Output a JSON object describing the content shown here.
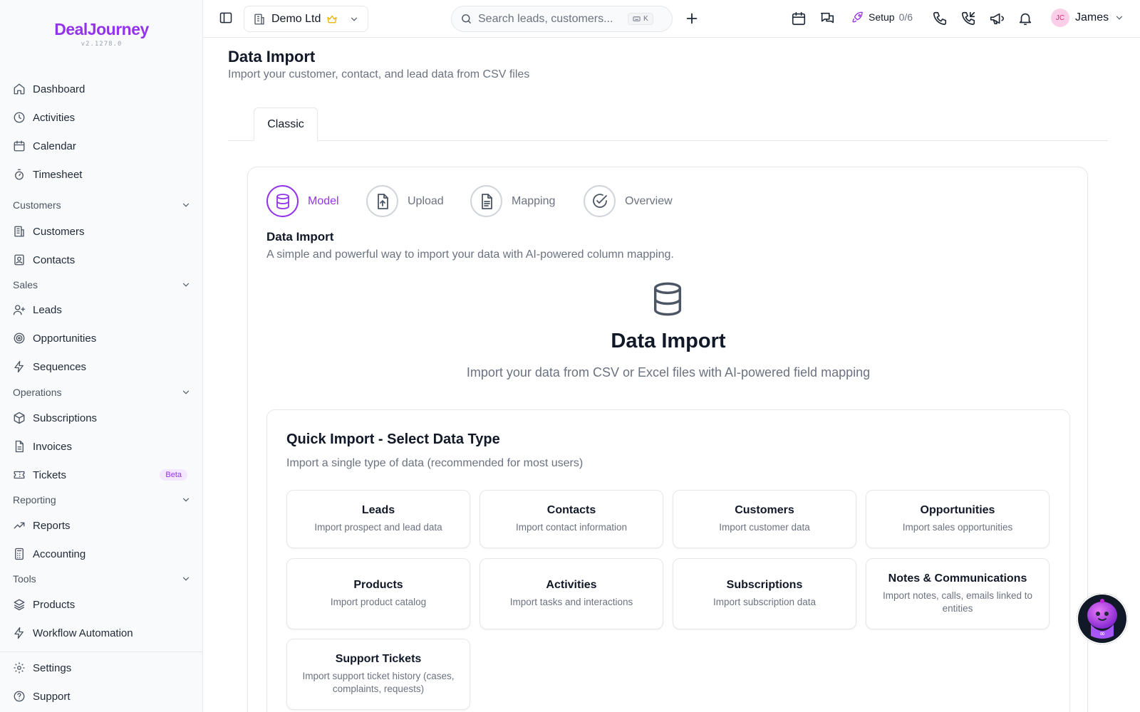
{
  "logo": {
    "name": "DealJourney",
    "version": "v2.1278.0"
  },
  "sidebar": {
    "items": [
      {
        "label": "Dashboard",
        "icon": "home-icon"
      },
      {
        "label": "Activities",
        "icon": "clock-icon"
      },
      {
        "label": "Calendar",
        "icon": "calendar-icon"
      },
      {
        "label": "Timesheet",
        "icon": "stopwatch-icon"
      }
    ],
    "sections": [
      {
        "label": "Customers",
        "items": [
          {
            "label": "Customers",
            "icon": "building-icon"
          },
          {
            "label": "Contacts",
            "icon": "contact-icon"
          }
        ]
      },
      {
        "label": "Sales",
        "items": [
          {
            "label": "Leads",
            "icon": "user-plus-icon"
          },
          {
            "label": "Opportunities",
            "icon": "target-icon"
          },
          {
            "label": "Sequences",
            "icon": "zap-icon"
          }
        ]
      },
      {
        "label": "Operations",
        "items": [
          {
            "label": "Subscriptions",
            "icon": "package-icon"
          },
          {
            "label": "Invoices",
            "icon": "file-icon"
          },
          {
            "label": "Tickets",
            "icon": "ticket-icon",
            "badge": "Beta"
          }
        ]
      },
      {
        "label": "Reporting",
        "items": [
          {
            "label": "Reports",
            "icon": "trending-up-icon"
          },
          {
            "label": "Accounting",
            "icon": "calculator-icon"
          }
        ]
      },
      {
        "label": "Tools",
        "items": [
          {
            "label": "Products",
            "icon": "layers-icon"
          },
          {
            "label": "Workflow Automation",
            "icon": "zap-icon"
          }
        ]
      }
    ],
    "footer": [
      {
        "label": "Settings",
        "icon": "gear-icon"
      },
      {
        "label": "Support",
        "icon": "help-icon"
      }
    ]
  },
  "topbar": {
    "company": "Demo Ltd",
    "search_placeholder": "Search leads, customers...",
    "shortcut": "K",
    "setup_label": "Setup",
    "setup_count": "0/6",
    "user_initials": "JC",
    "user_name": "James"
  },
  "page": {
    "title": "Data Import",
    "subtitle": "Import your customer, contact, and lead data from CSV files",
    "tab": "Classic"
  },
  "wizard": {
    "steps": [
      {
        "label": "Model",
        "active": true
      },
      {
        "label": "Upload",
        "active": false
      },
      {
        "label": "Mapping",
        "active": false
      },
      {
        "label": "Overview",
        "active": false
      }
    ],
    "section_title": "Data Import",
    "section_desc": "A simple and powerful way to import your data with AI-powered column mapping.",
    "hero_title": "Data Import",
    "hero_sub": "Import your data from CSV or Excel files with AI-powered field mapping"
  },
  "quick_import": {
    "title": "Quick Import - Select Data Type",
    "subtitle": "Import a single type of data (recommended for most users)",
    "tiles": [
      {
        "title": "Leads",
        "desc": "Import prospect and lead data"
      },
      {
        "title": "Contacts",
        "desc": "Import contact information"
      },
      {
        "title": "Customers",
        "desc": "Import customer data"
      },
      {
        "title": "Opportunities",
        "desc": "Import sales opportunities"
      },
      {
        "title": "Products",
        "desc": "Import product catalog"
      },
      {
        "title": "Activities",
        "desc": "Import tasks and interactions"
      },
      {
        "title": "Subscriptions",
        "desc": "Import subscription data"
      },
      {
        "title": "Notes & Communications",
        "desc": "Import notes, calls, emails linked to entities"
      },
      {
        "title": "Support Tickets",
        "desc": "Import support ticket history (cases, complaints, requests)"
      }
    ]
  },
  "colors": {
    "accent": "#9333ea",
    "muted": "#6b7280",
    "border": "#e5e7eb"
  }
}
